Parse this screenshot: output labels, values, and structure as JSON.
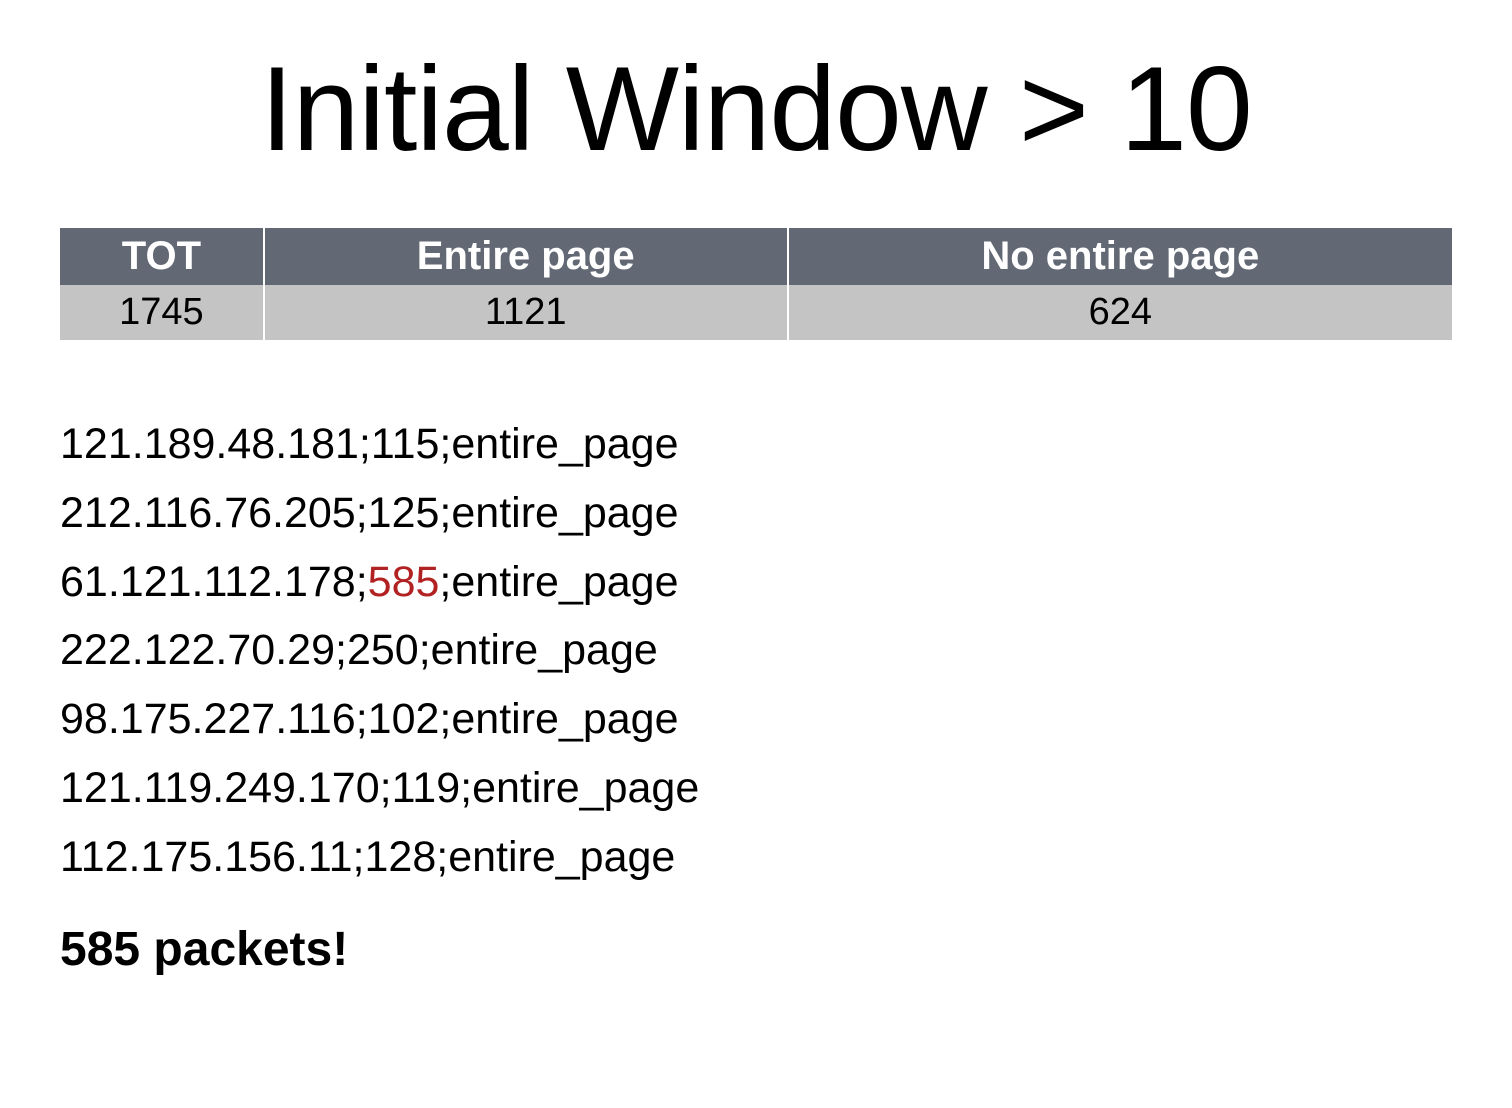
{
  "title": "Initial Window > 10",
  "table": {
    "headers": [
      "TOT",
      "Entire page",
      "No entire page"
    ],
    "row": [
      "1745",
      "1121",
      "624"
    ]
  },
  "log_lines": [
    {
      "ip": "121.189.48.181",
      "count": "115",
      "tag": "entire_page",
      "highlight": false
    },
    {
      "ip": "212.116.76.205",
      "count": "125",
      "tag": "entire_page",
      "highlight": false
    },
    {
      "ip": "61.121.112.178",
      "count": "585",
      "tag": "entire_page",
      "highlight": true
    },
    {
      "ip": "222.122.70.29",
      "count": "250",
      "tag": "entire_page",
      "highlight": false
    },
    {
      "ip": "98.175.227.116",
      "count": "102",
      "tag": "entire_page",
      "highlight": false
    },
    {
      "ip": "121.119.249.170",
      "count": "119",
      "tag": "entire_page",
      "highlight": false
    },
    {
      "ip": "112.175.156.11",
      "count": "128",
      "tag": "entire_page",
      "highlight": false
    }
  ],
  "callout": "585 packets!"
}
